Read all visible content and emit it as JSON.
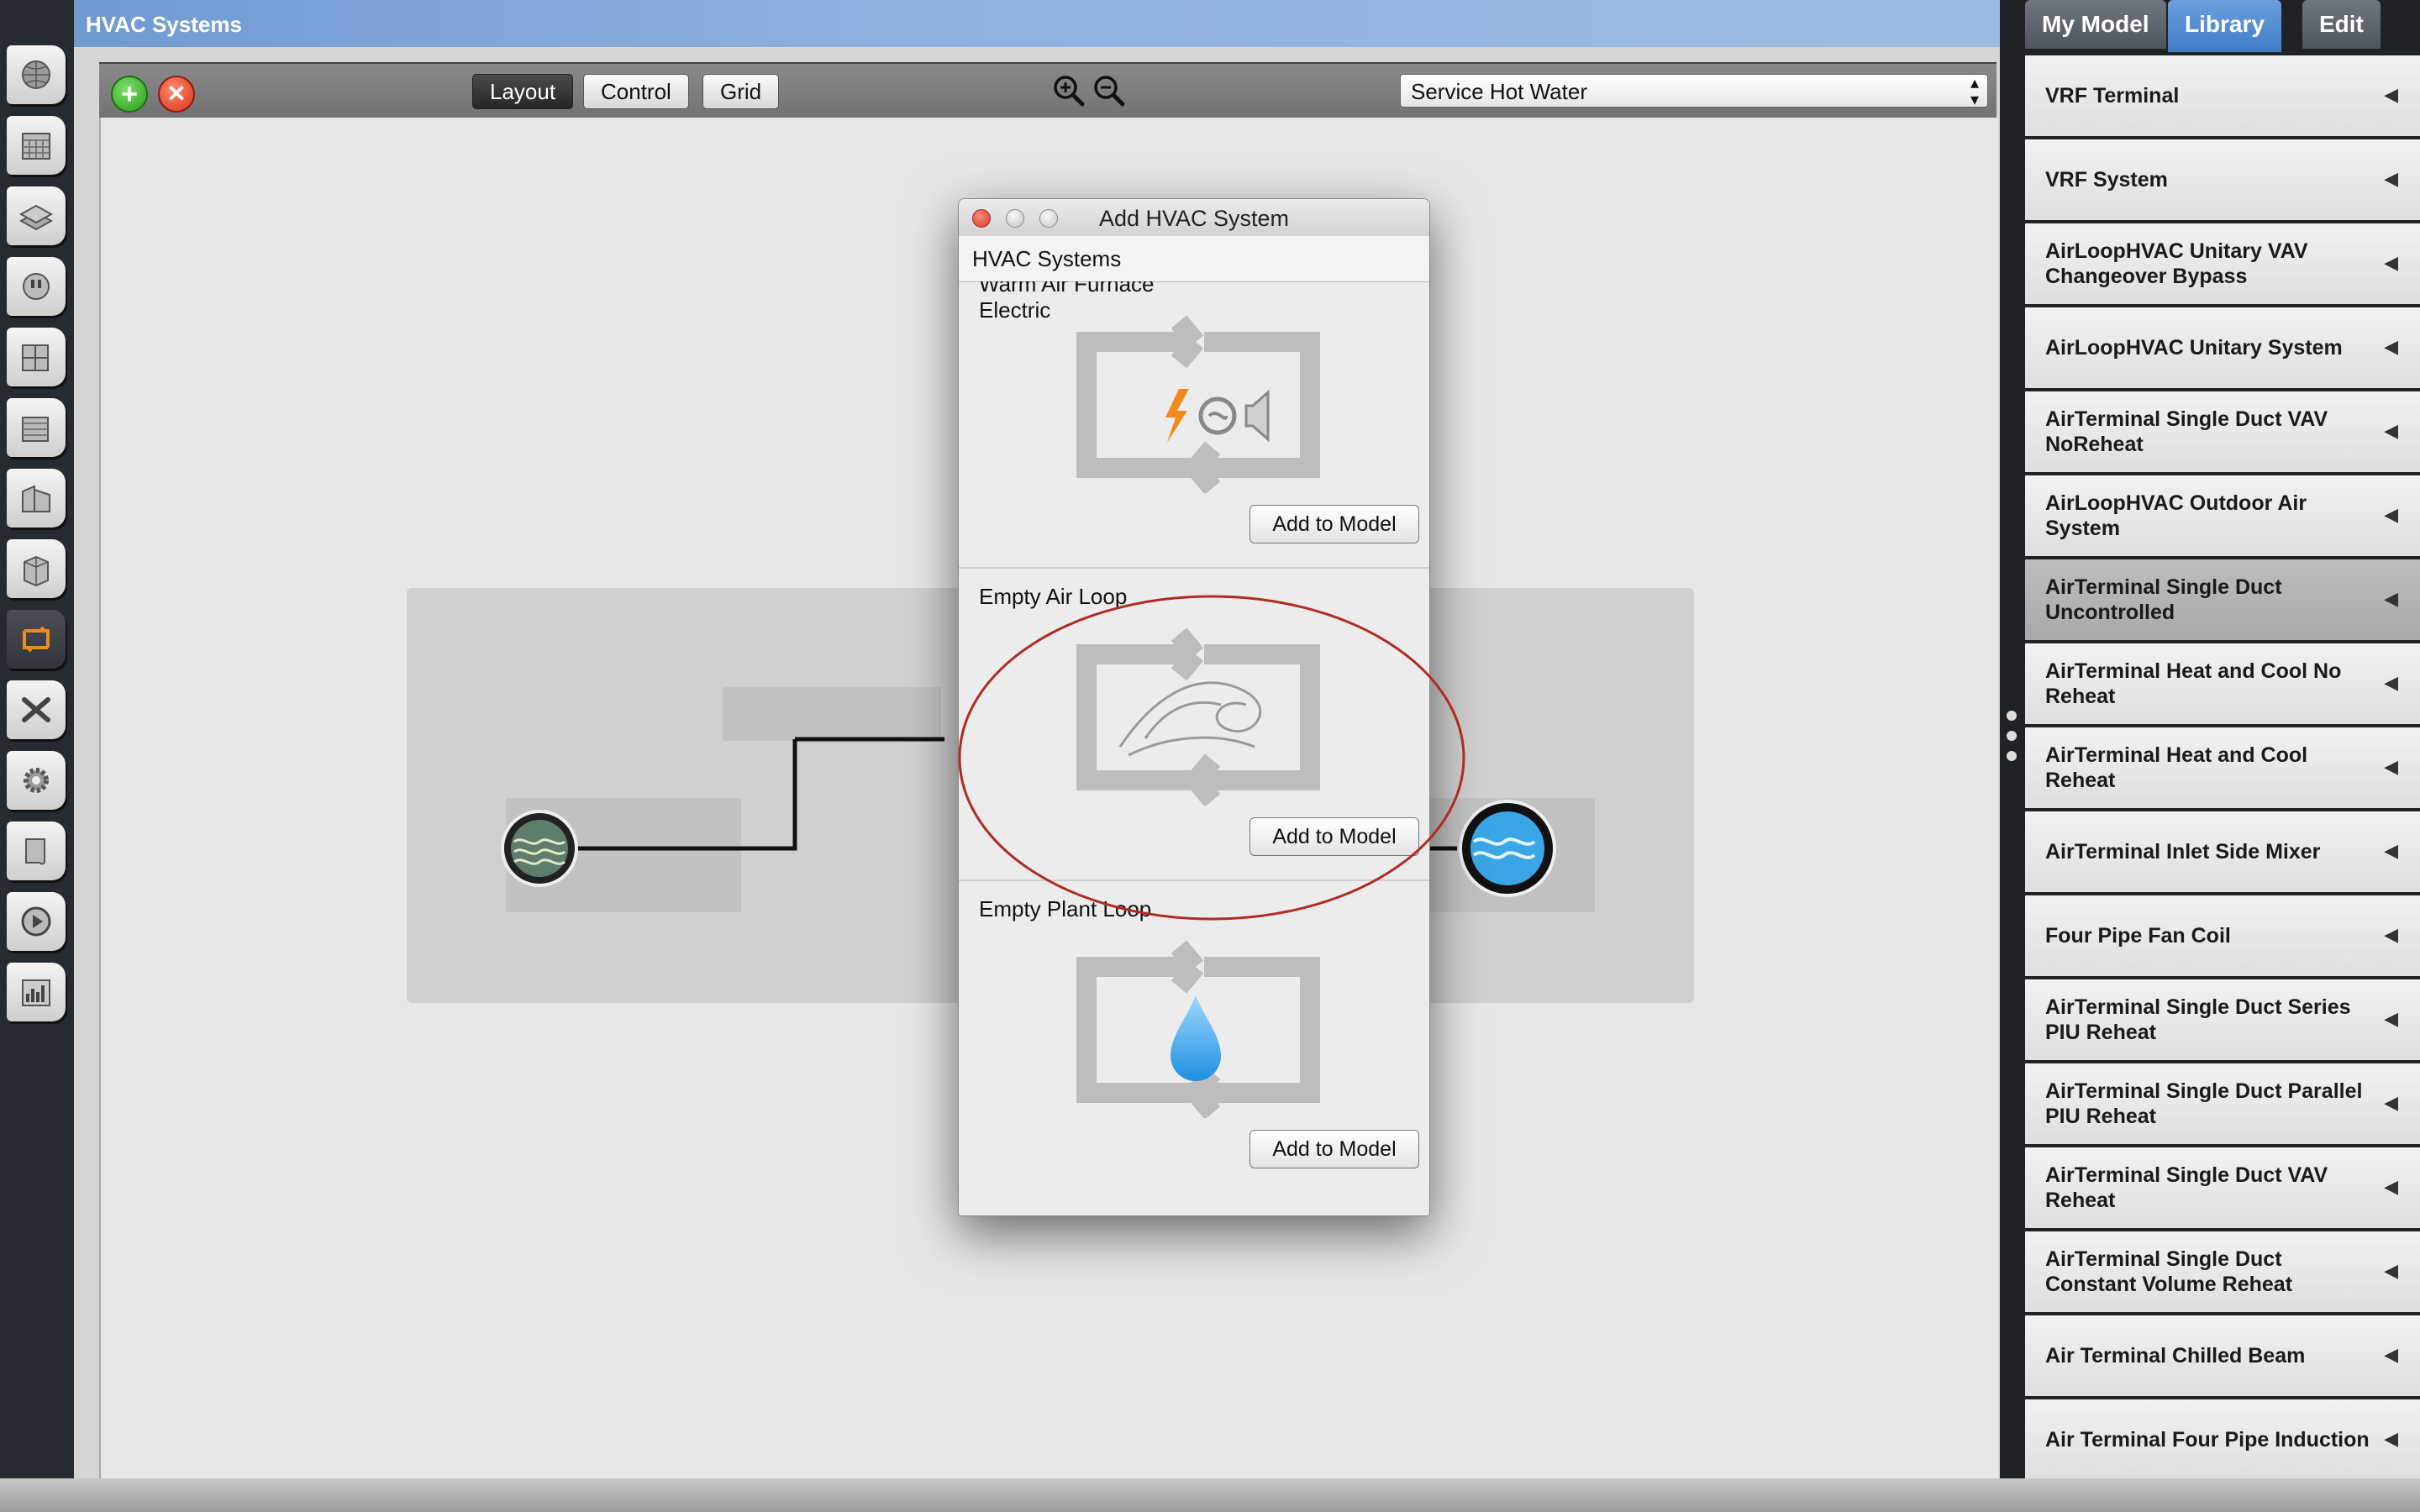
{
  "left_toolbar": {
    "items": [
      {
        "name": "site-icon"
      },
      {
        "name": "schedules-icon"
      },
      {
        "name": "constructions-icon"
      },
      {
        "name": "loads-icon"
      },
      {
        "name": "space-types-icon"
      },
      {
        "name": "geometry-icon"
      },
      {
        "name": "facility-icon"
      },
      {
        "name": "spaces-icon"
      },
      {
        "name": "hvac-systems-icon"
      },
      {
        "name": "building-summary-icon"
      },
      {
        "name": "measures-icon"
      },
      {
        "name": "simulation-settings-icon"
      },
      {
        "name": "scripts-icon"
      },
      {
        "name": "run-simulation-icon"
      },
      {
        "name": "results-summary-icon"
      }
    ]
  },
  "main": {
    "title": "HVAC Systems",
    "toolbar": {
      "layout_label": "Layout",
      "control_label": "Control",
      "grid_label": "Grid",
      "loop_select_value": "Service Hot Water"
    }
  },
  "right_panel": {
    "tabs": [
      "My Model",
      "Library",
      "Edit"
    ],
    "active_tab": "Library",
    "library_items": [
      "VRF Terminal",
      "VRF System",
      "AirLoopHVAC Unitary VAV Changeover Bypass",
      "AirLoopHVAC Unitary System",
      "AirTerminal Single Duct VAV NoReheat",
      "AirLoopHVAC Outdoor Air System",
      "AirTerminal Single Duct Uncontrolled",
      "AirTerminal Heat and Cool No Reheat",
      "AirTerminal Heat and Cool Reheat",
      "AirTerminal Inlet Side Mixer",
      "Four Pipe Fan Coil",
      "AirTerminal Single Duct Series PIU Reheat",
      "AirTerminal Single Duct Parallel PIU Reheat",
      "AirTerminal Single Duct VAV Reheat",
      "AirTerminal Single Duct Constant Volume Reheat",
      "Air Terminal Chilled Beam",
      "Air Terminal Four Pipe Induction"
    ],
    "selected_item": "AirTerminal Single Duct Uncontrolled"
  },
  "dialog": {
    "title": "Add HVAC System",
    "header": "HVAC Systems",
    "systems": [
      {
        "name": "Warm Air Furnace\nElectric",
        "button": "Add to Model"
      },
      {
        "name": "Empty Air Loop",
        "button": "Add to Model"
      },
      {
        "name": "Empty Plant Loop",
        "button": "Add to Model"
      }
    ]
  },
  "colors": {
    "accent_blue": "#3f7cc8",
    "title_bar_blue": "#8db1de",
    "annotation_red": "#b22a22",
    "water_blue": "#3aa6e6"
  }
}
